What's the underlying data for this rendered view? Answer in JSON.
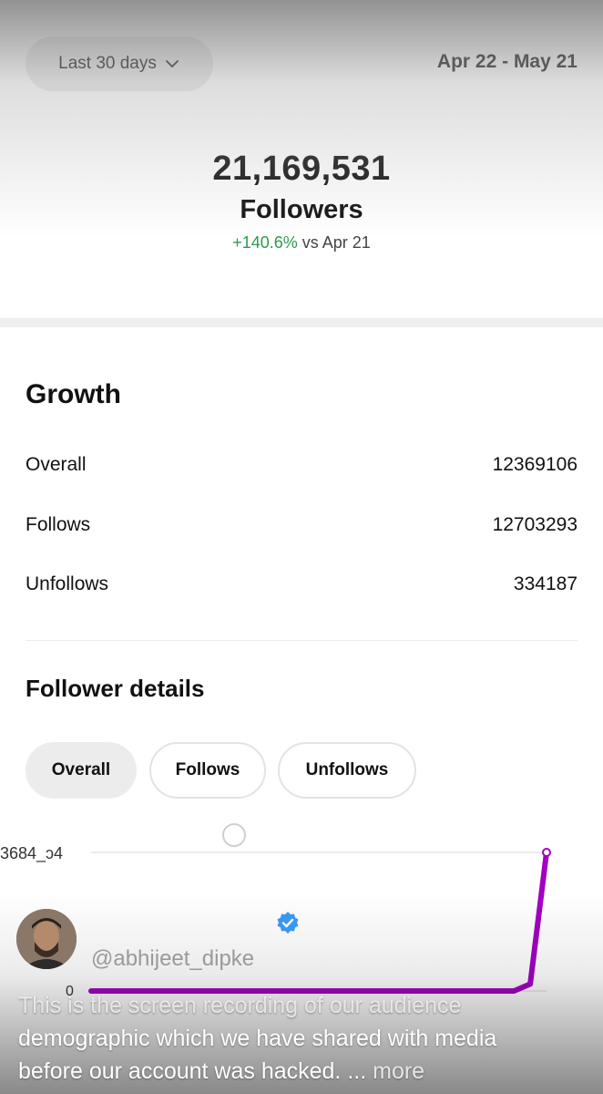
{
  "header": {
    "range_label": "Last 30 days",
    "date_range": "Apr 22 - May 21"
  },
  "summary": {
    "total": "21,169,531",
    "label": "Followers",
    "change": "+140.6%",
    "compare": "vs Apr 21"
  },
  "growth": {
    "title": "Growth",
    "rows": [
      {
        "label": "Overall",
        "value": "12369106"
      },
      {
        "label": "Follows",
        "value": "12703293"
      },
      {
        "label": "Unfollows",
        "value": "334187"
      }
    ]
  },
  "details": {
    "title": "Follower details",
    "tabs": [
      "Overall",
      "Follows",
      "Unfollows"
    ],
    "selected": "Overall"
  },
  "chart_data": {
    "type": "line",
    "y_labels": [
      "3684_ɔ4",
      "0"
    ],
    "series": [
      {
        "values": [
          0,
          0,
          0,
          0,
          0,
          0,
          0,
          0,
          0,
          0,
          0,
          0,
          0,
          0,
          0,
          0,
          0,
          0,
          0,
          0,
          0,
          0,
          0,
          0,
          0,
          0,
          0,
          0.05,
          1.0
        ]
      }
    ],
    "color": "#a100c2"
  },
  "post": {
    "handle": "@abhijeet_dipke",
    "caption_line1": "This is the screen recording of our audience",
    "caption_line2": "demographic which we have shared with media",
    "caption_line3": "before our account was hacked. ...",
    "more": "more"
  }
}
